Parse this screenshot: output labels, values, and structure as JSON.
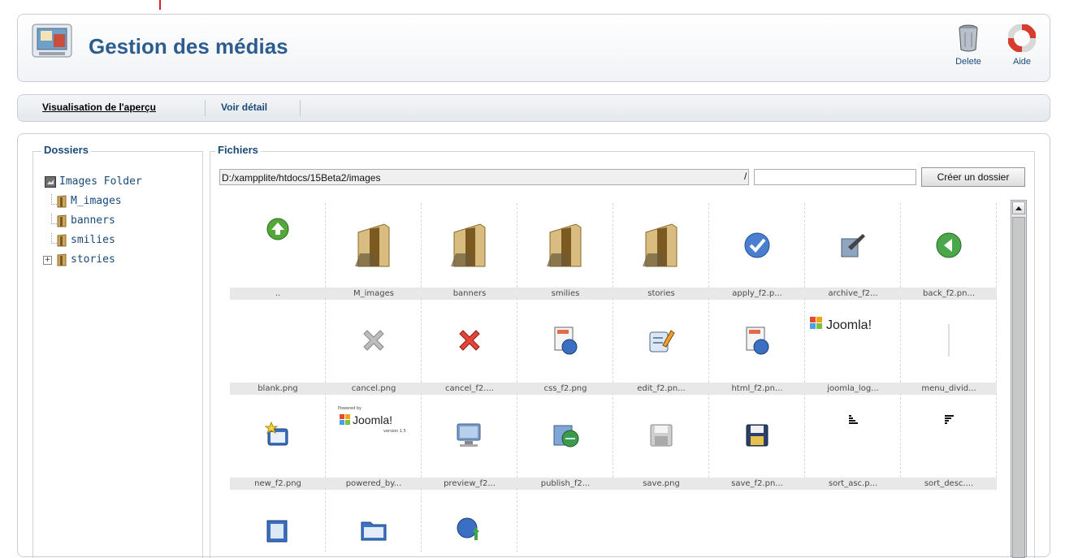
{
  "header": {
    "title": "Gestion des médias"
  },
  "toolbar": {
    "delete_label": "Delete",
    "help_label": "Aide"
  },
  "submenu": {
    "preview": "Visualisation de l'aperçu",
    "detail": "Voir détail"
  },
  "dossiers": {
    "legend": "Dossiers",
    "root": "Images Folder",
    "children": [
      "M_images",
      "banners",
      "smilies",
      "stories"
    ]
  },
  "fichiers": {
    "legend": "Fichiers",
    "path": "D:/xampplite/htdocs/15Beta2/images",
    "slash": "/",
    "create_button": "Créer un dossier",
    "items": [
      {
        "name": "..",
        "icon": "up-arrow-icon"
      },
      {
        "name": "M_images",
        "icon": "folder-icon"
      },
      {
        "name": "banners",
        "icon": "folder-icon"
      },
      {
        "name": "smilies",
        "icon": "folder-icon"
      },
      {
        "name": "stories",
        "icon": "folder-icon"
      },
      {
        "name": "apply_f2.p...",
        "icon": "checkmark-icon"
      },
      {
        "name": "archive_f2...",
        "icon": "archive-icon"
      },
      {
        "name": "back_f2.pn...",
        "icon": "back-arrow-icon"
      },
      {
        "name": "blank.png",
        "icon": "blank-icon"
      },
      {
        "name": "cancel.png",
        "icon": "cancel-grey-icon"
      },
      {
        "name": "cancel_f2....",
        "icon": "cancel-red-icon"
      },
      {
        "name": "css_f2.png",
        "icon": "css-globe-icon"
      },
      {
        "name": "edit_f2.pn...",
        "icon": "edit-icon"
      },
      {
        "name": "html_f2.pn...",
        "icon": "html-globe-icon"
      },
      {
        "name": "joomla_log...",
        "icon": "joomla-logo-icon",
        "text": "Joomla!"
      },
      {
        "name": "menu_divid...",
        "icon": "menu-divider-icon"
      },
      {
        "name": "new_f2.png",
        "icon": "new-icon"
      },
      {
        "name": "powered_by...",
        "icon": "powered-by-icon",
        "text": "Joomla!"
      },
      {
        "name": "preview_f2...",
        "icon": "monitor-icon"
      },
      {
        "name": "publish_f2...",
        "icon": "publish-icon"
      },
      {
        "name": "save.png",
        "icon": "save-grey-icon"
      },
      {
        "name": "save_f2.pn...",
        "icon": "save-icon"
      },
      {
        "name": "sort_asc.p...",
        "icon": "sort-asc-icon"
      },
      {
        "name": "sort_desc....",
        "icon": "sort-desc-icon"
      },
      {
        "name": "",
        "icon": "unarchive-icon"
      },
      {
        "name": "",
        "icon": "folder-open-icon"
      },
      {
        "name": "",
        "icon": "upload-globe-icon"
      }
    ]
  }
}
